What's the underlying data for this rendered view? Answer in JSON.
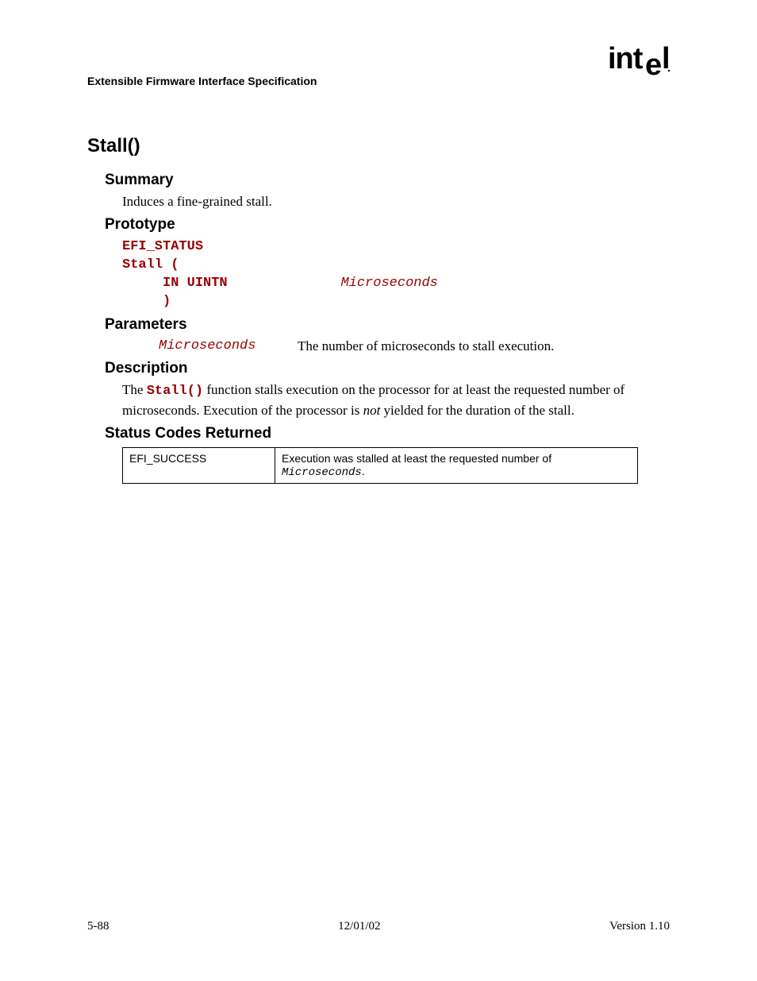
{
  "header": {
    "title": "Extensible Firmware Interface Specification",
    "logo_text": "intel"
  },
  "main": {
    "title": "Stall()",
    "summary": {
      "heading": "Summary",
      "text": "Induces a fine-grained stall."
    },
    "prototype": {
      "heading": "Prototype",
      "line1": "EFI_STATUS",
      "line2": "Stall (",
      "line3_kw": "     IN UINTN              ",
      "line3_param": "Microseconds",
      "line4": "     )"
    },
    "parameters": {
      "heading": "Parameters",
      "items": [
        {
          "name": "Microseconds",
          "desc": "The number of microseconds to stall execution."
        }
      ]
    },
    "description": {
      "heading": "Description",
      "pre": "The ",
      "code": "Stall()",
      "mid": " function stalls execution on the processor for at least the requested number of microseconds.  Execution of the processor is ",
      "italic": "not",
      "post": " yielded for the duration of the stall."
    },
    "status": {
      "heading": "Status Codes Returned",
      "rows": [
        {
          "code": "EFI_SUCCESS",
          "desc_pre": "Execution was stalled at least the requested number of ",
          "desc_code": "Microseconds",
          "desc_post": "."
        }
      ]
    }
  },
  "footer": {
    "left": "5-88",
    "center": "12/01/02",
    "right": "Version 1.10"
  }
}
